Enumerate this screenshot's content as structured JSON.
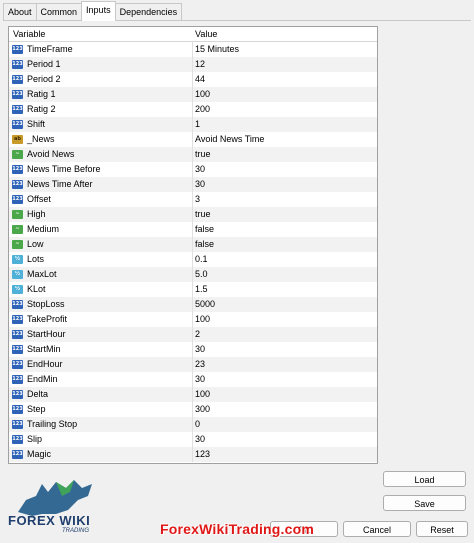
{
  "tabs": [
    {
      "label": "About"
    },
    {
      "label": "Common"
    },
    {
      "label": "Inputs"
    },
    {
      "label": "Dependencies"
    }
  ],
  "grid": {
    "header_variable": "Variable",
    "header_value": "Value",
    "rows": [
      {
        "icon": "int-icon",
        "name": "TimeFrame",
        "value": "15 Minutes"
      },
      {
        "icon": "int-icon",
        "name": "Period 1",
        "value": "12"
      },
      {
        "icon": "int-icon",
        "name": "Period 2",
        "value": "44"
      },
      {
        "icon": "int-icon",
        "name": "Ratig 1",
        "value": "100"
      },
      {
        "icon": "int-icon",
        "name": "Ratig 2",
        "value": "200"
      },
      {
        "icon": "int-icon",
        "name": "Shift",
        "value": "1"
      },
      {
        "icon": "string-icon",
        "name": "_News",
        "value": "Avoid News Time"
      },
      {
        "icon": "bool-icon",
        "name": "Avoid News",
        "value": "true"
      },
      {
        "icon": "int-icon",
        "name": "News Time Before",
        "value": "30"
      },
      {
        "icon": "int-icon",
        "name": "News Time After",
        "value": "30"
      },
      {
        "icon": "int-icon",
        "name": "Offset",
        "value": "3"
      },
      {
        "icon": "bool-icon",
        "name": "High",
        "value": "true"
      },
      {
        "icon": "bool-icon",
        "name": "Medium",
        "value": "false"
      },
      {
        "icon": "bool-icon",
        "name": "Low",
        "value": "false"
      },
      {
        "icon": "double-icon",
        "name": "Lots",
        "value": "0.1"
      },
      {
        "icon": "double-icon",
        "name": "MaxLot",
        "value": "5.0"
      },
      {
        "icon": "double-icon",
        "name": "KLot",
        "value": "1.5"
      },
      {
        "icon": "int-icon",
        "name": "StopLoss",
        "value": "5000"
      },
      {
        "icon": "int-icon",
        "name": "TakeProfit",
        "value": "100"
      },
      {
        "icon": "int-icon",
        "name": "StartHour",
        "value": "2"
      },
      {
        "icon": "int-icon",
        "name": "StartMin",
        "value": "30"
      },
      {
        "icon": "int-icon",
        "name": "EndHour",
        "value": "23"
      },
      {
        "icon": "int-icon",
        "name": "EndMin",
        "value": "30"
      },
      {
        "icon": "int-icon",
        "name": "Delta",
        "value": "100"
      },
      {
        "icon": "int-icon",
        "name": "Step",
        "value": "300"
      },
      {
        "icon": "int-icon",
        "name": "Trailing Stop",
        "value": "0"
      },
      {
        "icon": "int-icon",
        "name": "Slip",
        "value": "30"
      },
      {
        "icon": "int-icon",
        "name": "Magic",
        "value": "123"
      }
    ]
  },
  "buttons": {
    "load": "Load",
    "save": "Save",
    "ok": "OK",
    "cancel": "Cancel",
    "reset": "Reset"
  },
  "logo": {
    "brand": "FOREX WIKI",
    "sub": "TRADING"
  },
  "watermark": "ForexWikiTrading.com"
}
